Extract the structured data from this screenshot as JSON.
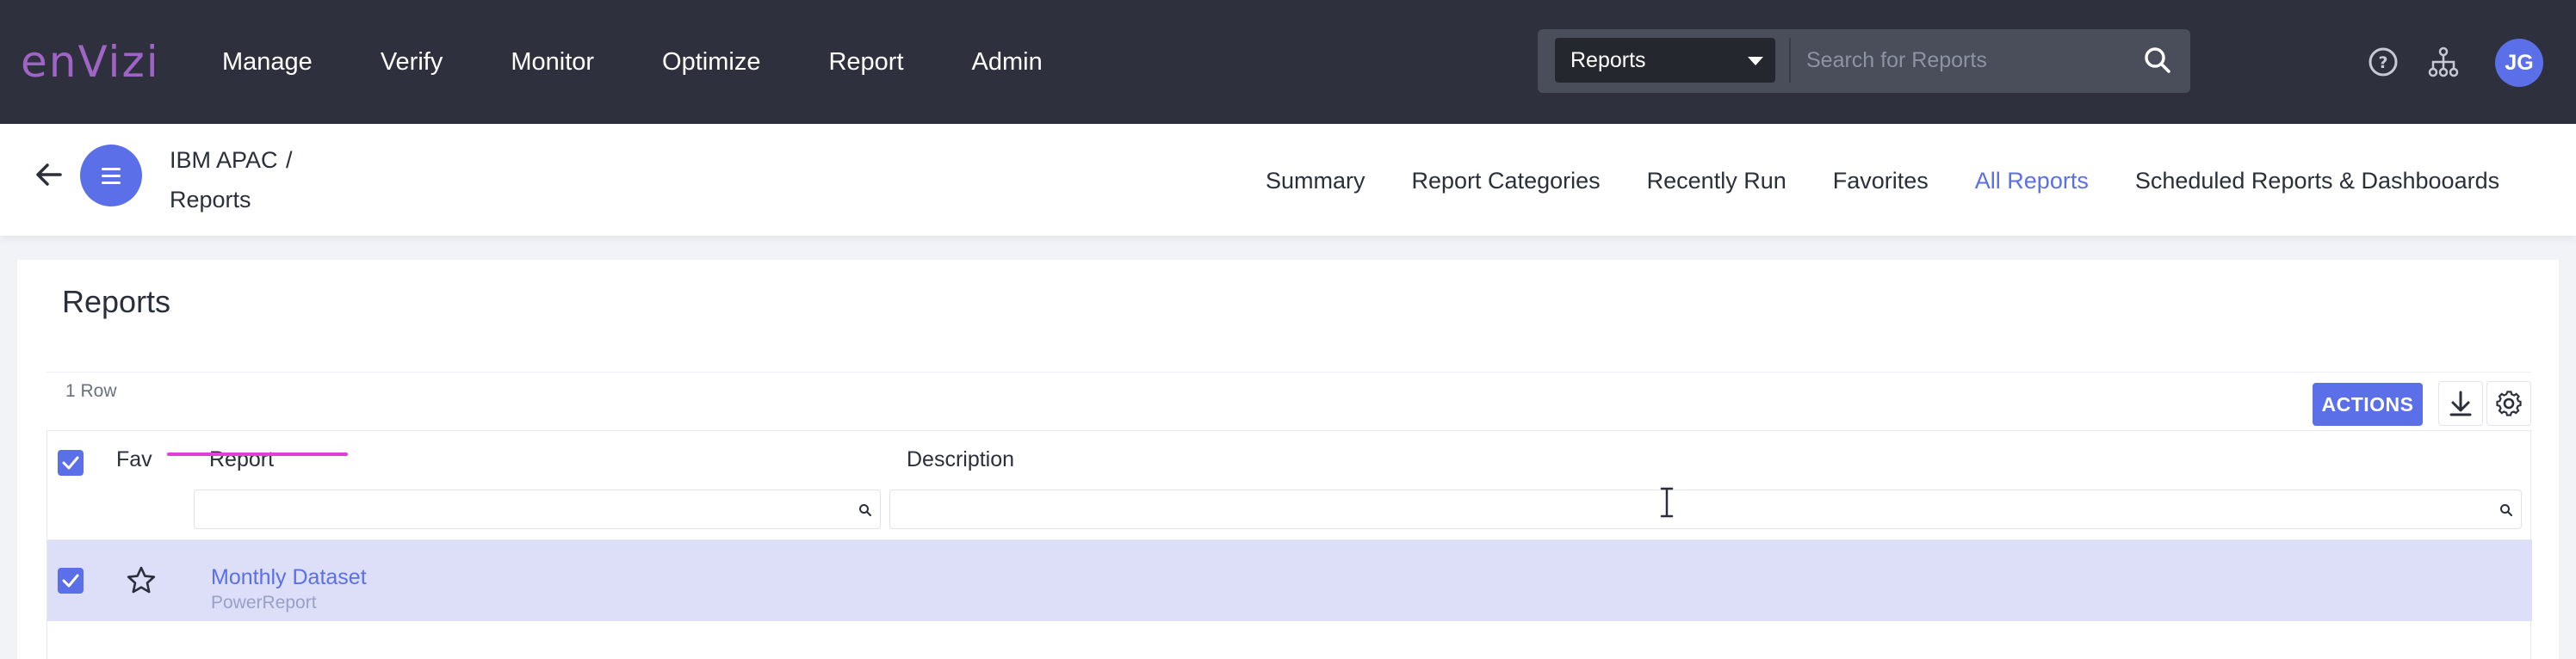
{
  "topbar": {
    "logo_text": "enVizi",
    "nav": [
      "Manage",
      "Verify",
      "Monitor",
      "Optimize",
      "Report",
      "Admin"
    ],
    "scope_select": "Reports",
    "search_placeholder": "Search for Reports",
    "user_initials": "JG",
    "icons": [
      "help-icon",
      "hierarchy-icon",
      "search-icon"
    ]
  },
  "subheader": {
    "breadcrumb_parent": "IBM APAC",
    "breadcrumb_separator": "/",
    "breadcrumb_current": "Reports",
    "tabs": [
      {
        "label": "Summary",
        "active": false
      },
      {
        "label": "Report Categories",
        "active": false
      },
      {
        "label": "Recently Run",
        "active": false
      },
      {
        "label": "Favorites",
        "active": false
      },
      {
        "label": "All Reports",
        "active": true
      },
      {
        "label": "Scheduled Reports & Dashbooards",
        "active": false
      }
    ]
  },
  "main": {
    "title": "Reports",
    "row_count": "1 Row",
    "actions_label": "ACTIONS",
    "columns": {
      "fav": "Fav",
      "report": "Report",
      "description": "Description"
    },
    "rows": [
      {
        "name": "Monthly Dataset",
        "type": "PowerReport",
        "description": "",
        "selected": true,
        "favorite": false
      }
    ]
  },
  "colors": {
    "topbar_bg": "#2e313d",
    "accent": "#5b6fe8",
    "logo": "#a064c6",
    "selected_row": "#dcdff7",
    "highlight_underline": "#e23fd9"
  }
}
